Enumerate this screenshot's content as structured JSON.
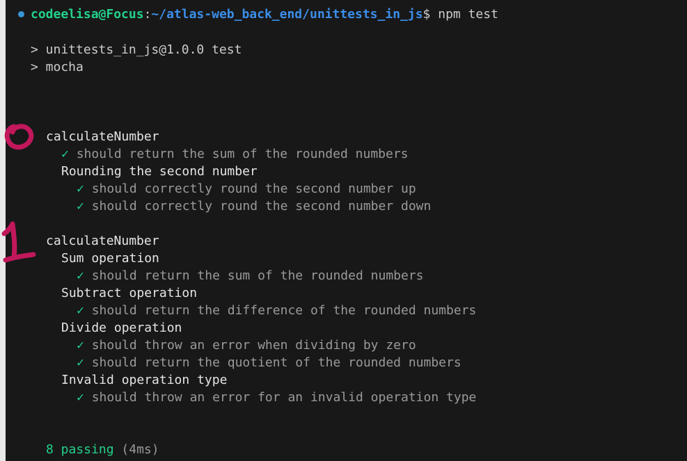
{
  "terminal": {
    "prompt": {
      "user_host": "codeelisa@Focus",
      "colon": ":",
      "path": "~/atlas-web_back_end/unittests_in_js",
      "dollar": "$",
      "command": " npm test"
    },
    "script_lines": [
      "> unittests_in_js@1.0.0 test",
      "> mocha"
    ],
    "suites": [
      {
        "title": "calculateNumber",
        "tests": [
          "should return the sum of the rounded numbers"
        ],
        "subsuites": [
          {
            "title": "Rounding the second number",
            "tests": [
              "should correctly round the second number up",
              "should correctly round the second number down"
            ]
          }
        ]
      },
      {
        "title": "calculateNumber",
        "tests": [],
        "subsuites": [
          {
            "title": "Sum operation",
            "tests": [
              "should return the sum of the rounded numbers"
            ]
          },
          {
            "title": "Subtract operation",
            "tests": [
              "should return the difference of the rounded numbers"
            ]
          },
          {
            "title": "Divide operation",
            "tests": [
              "should throw an error when dividing by zero",
              "should return the quotient of the rounded numbers"
            ]
          },
          {
            "title": "Invalid operation type",
            "tests": [
              "should throw an error for an invalid operation type"
            ]
          }
        ]
      }
    ],
    "check_glyph": "✓",
    "summary": {
      "passing": "8 passing",
      "duration": "(4ms)"
    }
  },
  "annotations": {
    "color": "#c2185b",
    "marks": [
      "0",
      "1"
    ]
  }
}
